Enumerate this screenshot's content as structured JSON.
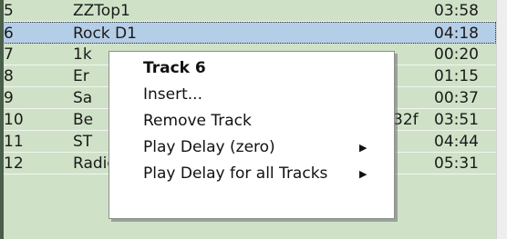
{
  "tracks": [
    {
      "num": "5",
      "title": "ZZTop1",
      "duration": "03:58"
    },
    {
      "num": "6",
      "title": "Rock D1",
      "duration": "04:18"
    },
    {
      "num": "7",
      "title": "1k",
      "duration": "00:20"
    },
    {
      "num": "8",
      "title": "Er",
      "duration": "01:15"
    },
    {
      "num": "9",
      "title": "Sa",
      "duration": "00:37"
    },
    {
      "num": "10",
      "title": "Be",
      "duration": "03:51"
    },
    {
      "num": "11",
      "title": "ST",
      "duration": "04:44"
    },
    {
      "num": "12",
      "title": "RadioGaga",
      "duration": "05:31"
    }
  ],
  "row8_overflow": "32f",
  "context_menu": {
    "header": "Track 6",
    "insert": "Insert...",
    "remove": "Remove Track",
    "play_delay": "Play Delay (zero)",
    "play_delay_all": "Play Delay for all Tracks",
    "submenu_arrow": "▶"
  },
  "colors": {
    "row_background": "#cfe2c8",
    "selected_row": "#b5cee7",
    "menu_background": "#ffffff"
  }
}
